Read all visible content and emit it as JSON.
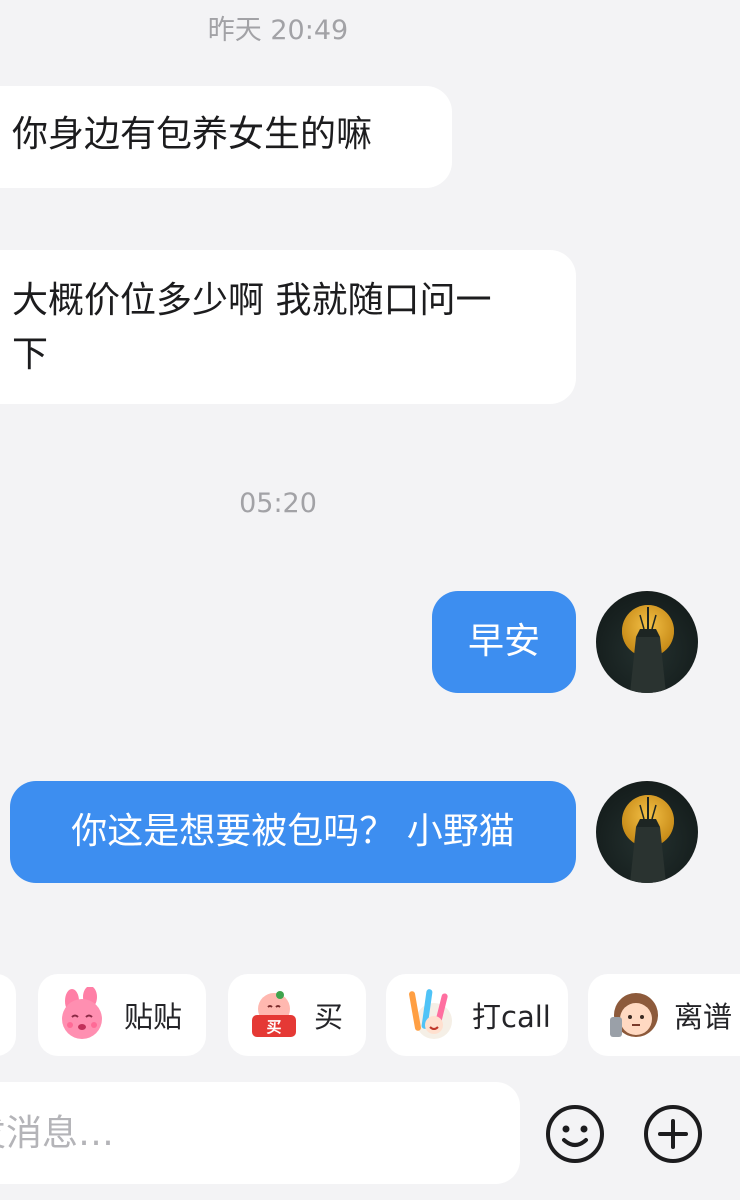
{
  "timestamps": [
    "昨天 20:49",
    "05:20"
  ],
  "messages": [
    {
      "side": "incoming",
      "text": "你身边有包养女生的嘛"
    },
    {
      "side": "incoming",
      "text": "大概价位多少啊 我就随口问一下"
    },
    {
      "side": "outgoing",
      "text": "早安"
    },
    {
      "side": "outgoing",
      "text": "你这是想要被包吗？ 小野猫"
    }
  ],
  "quick_replies": [
    {
      "label": "",
      "icon": "sticker-icon"
    },
    {
      "label": "贴贴",
      "icon": "hug-sticker-icon"
    },
    {
      "label": "买",
      "icon": "buy-sticker-icon"
    },
    {
      "label": "打call",
      "icon": "glowstick-sticker-icon"
    },
    {
      "label": "离谱",
      "icon": "shocked-sticker-icon"
    }
  ],
  "input": {
    "placeholder": "发消息…"
  },
  "toolbar": {
    "emoji_icon": "smiley-icon",
    "plus_icon": "plus-circle-icon"
  },
  "colors": {
    "outgoing_bubble": "#3d8ef0",
    "incoming_bubble": "#ffffff",
    "background": "#f3f3f5"
  }
}
